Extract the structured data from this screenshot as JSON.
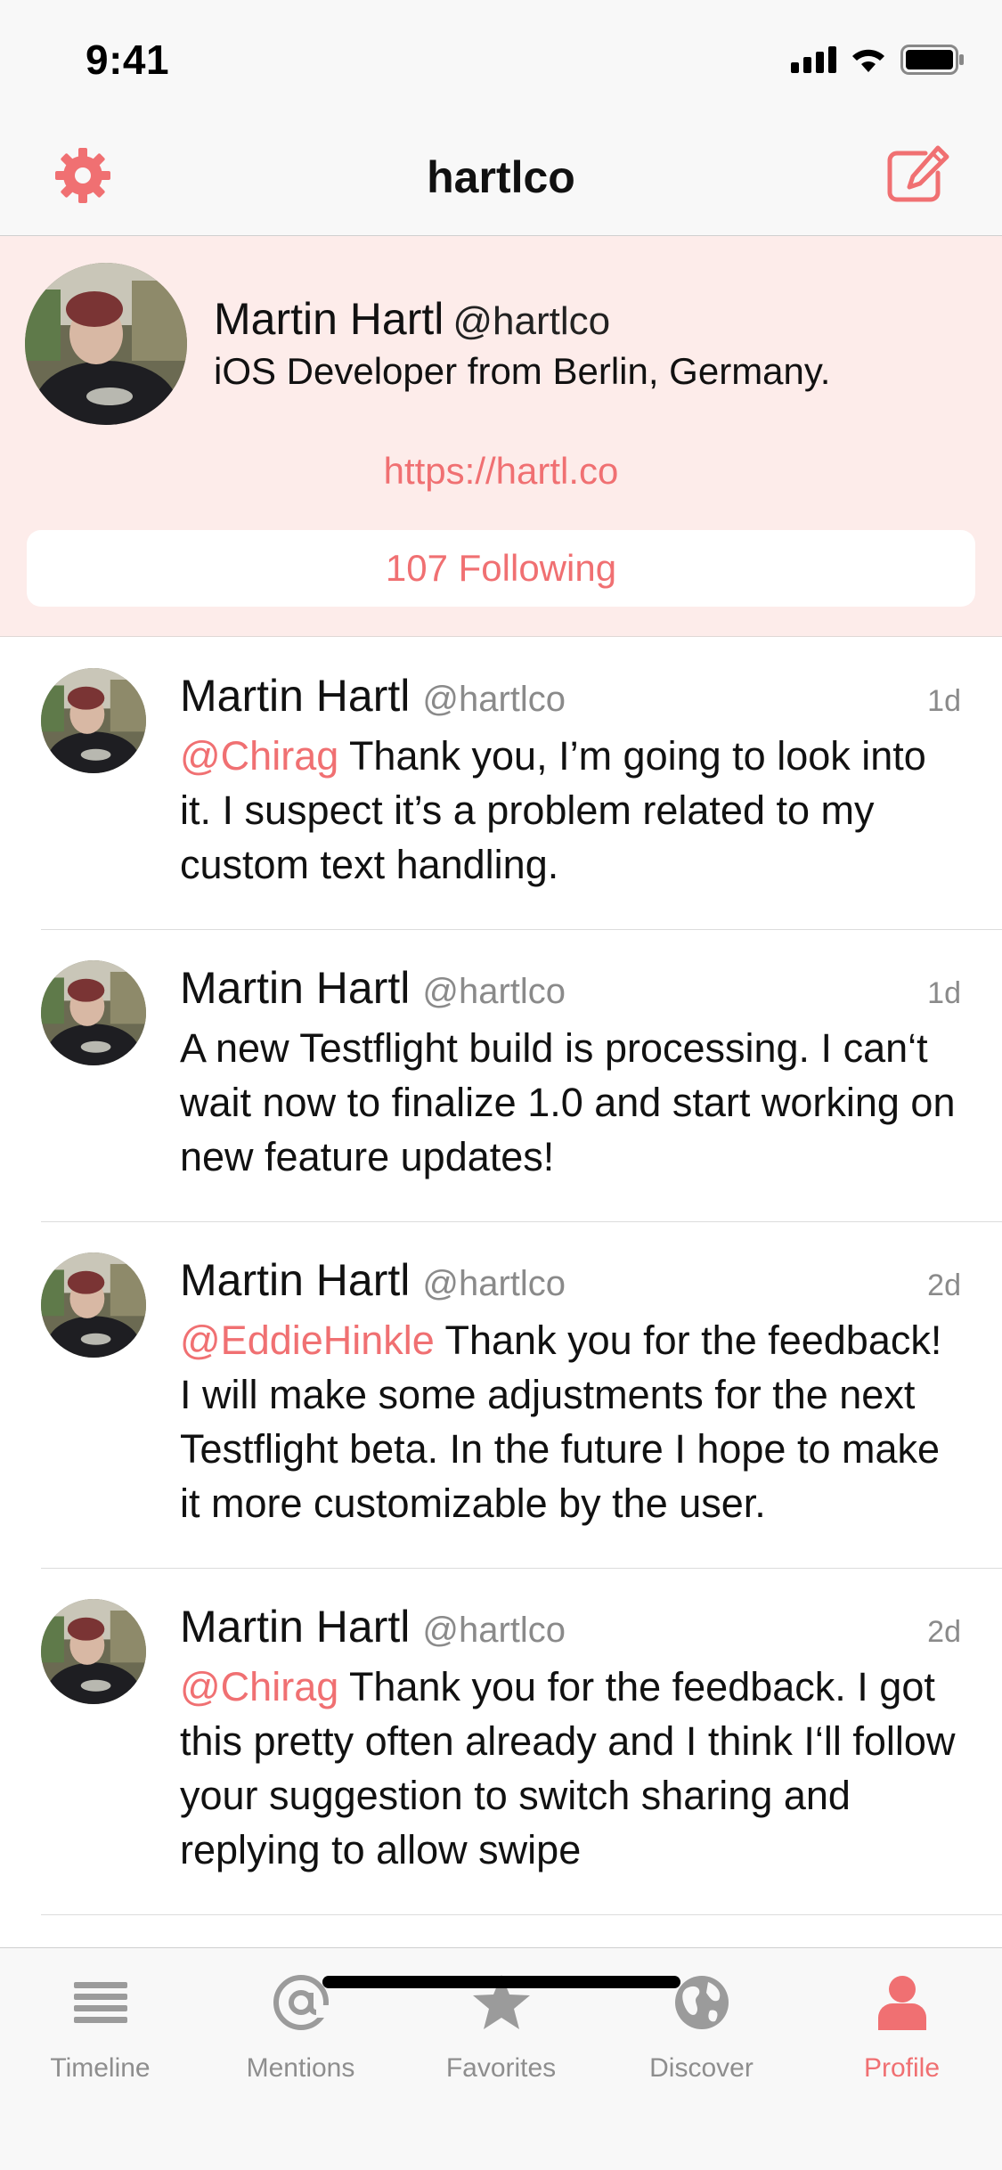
{
  "status_bar": {
    "time": "9:41"
  },
  "nav": {
    "title": "hartlco",
    "settings_icon": "gear-icon",
    "compose_icon": "compose-icon"
  },
  "profile": {
    "name": "Martin Hartl",
    "handle": "@hartlco",
    "bio": "iOS Developer from Berlin, Germany.",
    "link": "https://hartl.co",
    "following": "107 Following"
  },
  "tweets": [
    {
      "name": "Martin Hartl",
      "handle": "@hartlco",
      "time": "1d",
      "mention": "@Chirag",
      "text": " Thank you, I’m going to look into it. I suspect it’s a problem related to my custom text handling."
    },
    {
      "name": "Martin Hartl",
      "handle": "@hartlco",
      "time": "1d",
      "mention": "",
      "text": "A new Testflight build is processing. I can‘t wait now to finalize 1.0 and start working on new feature updates!"
    },
    {
      "name": "Martin Hartl",
      "handle": "@hartlco",
      "time": "2d",
      "mention": "@EddieHinkle",
      "text": " Thank you for the feedback! I will make some adjustments for the next Testflight beta. In the future I hope to make it more customizable by the user."
    },
    {
      "name": "Martin Hartl",
      "handle": "@hartlco",
      "time": "2d",
      "mention": "@Chirag",
      "text": " Thank you for the feedback. I got this pretty often already and I think I‘ll follow your suggestion to switch sharing and replying to allow swipe"
    }
  ],
  "tabs": [
    {
      "label": "Timeline",
      "icon": "timeline-icon"
    },
    {
      "label": "Mentions",
      "icon": "at-icon"
    },
    {
      "label": "Favorites",
      "icon": "star-icon"
    },
    {
      "label": "Discover",
      "icon": "globe-icon"
    },
    {
      "label": "Profile",
      "icon": "person-icon",
      "active": true
    }
  ],
  "colors": {
    "accent": "#f07072",
    "header_bg": "#fdecea",
    "secondary_text": "#8a8a8a"
  }
}
